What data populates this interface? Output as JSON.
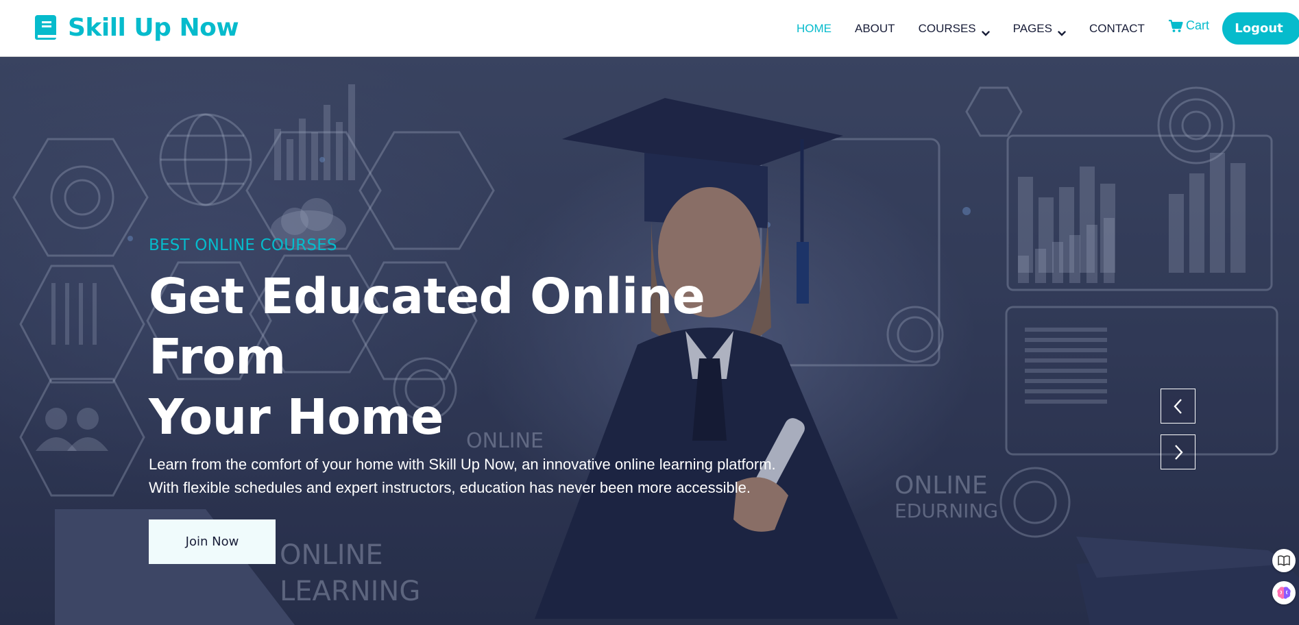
{
  "brand": {
    "name": "Skill Up Now",
    "icon": "book-icon",
    "color": "#06bbcc"
  },
  "nav": {
    "items": [
      {
        "label": "HOME",
        "active": true,
        "dropdown": false
      },
      {
        "label": "ABOUT",
        "active": false,
        "dropdown": false
      },
      {
        "label": "COURSES",
        "active": false,
        "dropdown": true
      },
      {
        "label": "PAGES",
        "active": false,
        "dropdown": true
      },
      {
        "label": "CONTACT",
        "active": false,
        "dropdown": false
      }
    ],
    "cart_label": "Cart",
    "cart_icon": "shopping-cart-icon",
    "logout_label": "Logout"
  },
  "hero": {
    "eyebrow": "BEST ONLINE COURSES",
    "headline_line1": "Get Educated Online From",
    "headline_line2": "Your Home",
    "lead_line1": "Learn from the comfort of your home with Skill Up Now, an innovative online learning platform.",
    "lead_line2": "With flexible schedules and expert instructors, education has never been more accessible.",
    "cta_label": "Join Now",
    "background_text": [
      "ONLINE",
      "ONLINE",
      "LEARNING",
      "ONLINE",
      "EDURNING"
    ],
    "prev_icon": "chevron-left-icon",
    "next_icon": "chevron-right-icon"
  },
  "side_tools": [
    "reader-icon",
    "brain-icon"
  ],
  "colors": {
    "accent": "#06bbcc",
    "dark": "#181d38",
    "hero_bg": "#3b4663"
  }
}
